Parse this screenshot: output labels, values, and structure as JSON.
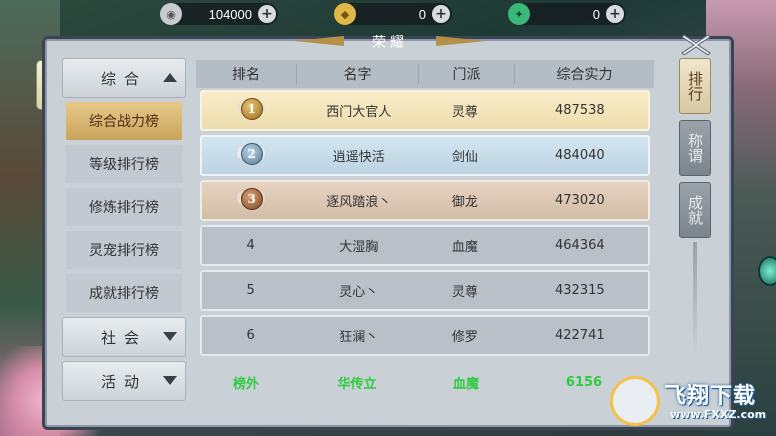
{
  "currencies": [
    {
      "icon": "silver-coin-icon",
      "value": "104000",
      "color": "#c8ccd0"
    },
    {
      "icon": "gold-ingot-icon",
      "value": "0",
      "color": "#e0b848"
    },
    {
      "icon": "jade-icon",
      "value": "0",
      "color": "#3ab878"
    }
  ],
  "plus_label": "+",
  "panel": {
    "title": "荣耀"
  },
  "nav": {
    "groups": [
      {
        "label": "综合",
        "expanded": true
      },
      {
        "label": "社会",
        "expanded": false
      },
      {
        "label": "活动",
        "expanded": false
      }
    ],
    "items": [
      "综合战力榜",
      "等级排行榜",
      "修炼排行榜",
      "灵宠排行榜",
      "成就排行榜"
    ],
    "active_item": 0
  },
  "tabs": [
    {
      "label": "排行",
      "active": true
    },
    {
      "label": "称谓",
      "active": false
    },
    {
      "label": "成就",
      "active": false
    }
  ],
  "table": {
    "headers": [
      "排名",
      "名字",
      "门派",
      "综合实力"
    ],
    "rows": [
      {
        "rank": "1",
        "name": "西门大官人",
        "sect": "灵尊",
        "power": "487538",
        "tier": "gold"
      },
      {
        "rank": "2",
        "name": "逍遥快活",
        "sect": "剑仙",
        "power": "484040",
        "tier": "silver"
      },
      {
        "rank": "3",
        "name": "逐风踏浪丶",
        "sect": "御龙",
        "power": "473020",
        "tier": "bronze"
      },
      {
        "rank": "4",
        "name": "大湿胸",
        "sect": "血魔",
        "power": "464364",
        "tier": "normal"
      },
      {
        "rank": "5",
        "name": "灵心丶",
        "sect": "灵尊",
        "power": "432315",
        "tier": "normal"
      },
      {
        "rank": "6",
        "name": "狂澜丶",
        "sect": "修罗",
        "power": "422741",
        "tier": "normal"
      }
    ]
  },
  "my_rank": {
    "rank": "榜外",
    "name": "华传立",
    "sect": "血魔",
    "power": "6156"
  },
  "watermark": {
    "title": "飞翔下载",
    "url": "www.FXXZ.com"
  }
}
